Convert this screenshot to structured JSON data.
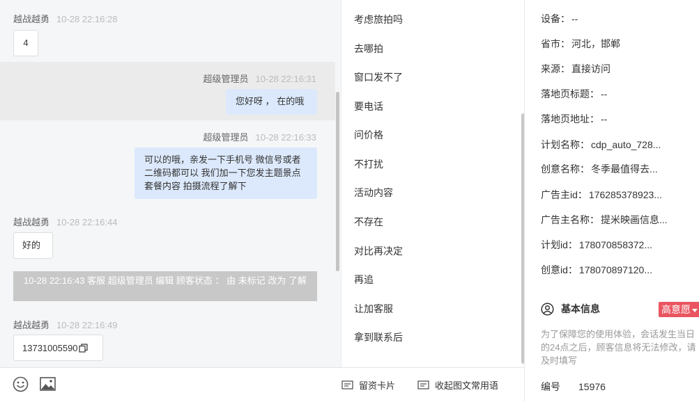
{
  "chat": {
    "messages": [
      {
        "sender": "越战越勇",
        "time": "10-28 22:16:28",
        "text": "4"
      },
      {
        "sender": "超级管理员",
        "time": "10-28 22:16:31",
        "text": "您好呀 ， 在的哦"
      },
      {
        "sender": "超级管理员",
        "time": "10-28 22:16:33",
        "text": "可以的哦，亲发一下手机号 微信号或者二维码都可以 我们加一下您发主题景点 套餐内容 拍摄流程了解下"
      },
      {
        "sender": "越战越勇",
        "time": "10-28 22:16:44",
        "text": "好的"
      },
      {
        "sender": "越战越勇",
        "time": "10-28 22:16:49",
        "text": "13731005590"
      }
    ],
    "system_note": "10-28 22:16:43 客服 超级管理员 编辑 顾客状态 ： 由 未标记 改为 了解"
  },
  "toolbar": {
    "lead_card_label": "留资卡片",
    "collapse_phrases_label": "收起图文常用语"
  },
  "phrases": [
    "考虑旅拍吗",
    "去哪拍",
    "窗口发不了",
    "要电话",
    "问价格",
    "不打扰",
    "活动内容",
    "不存在",
    "对比再决定",
    "再追",
    "让加客服",
    "拿到联系后"
  ],
  "info": {
    "fields": [
      {
        "label": "设备：",
        "value": "--"
      },
      {
        "label": "省市：",
        "value": "河北，邯郸"
      },
      {
        "label": "来源：",
        "value": "直接访问"
      },
      {
        "label": "落地页标题：",
        "value": "--"
      },
      {
        "label": "落地页地址：",
        "value": "--"
      },
      {
        "label": "计划名称：",
        "value": "cdp_auto_728..."
      },
      {
        "label": "创意名称：",
        "value": "冬季最值得去..."
      },
      {
        "label": "广告主id：",
        "value": "176285378923..."
      },
      {
        "label": "广告主名称：",
        "value": "提米映画信息..."
      },
      {
        "label": "计划id：",
        "value": "178070858372..."
      },
      {
        "label": "创意id：",
        "value": "178070897120..."
      }
    ],
    "basic_section_title": "基本信息",
    "intent_badge": "高意愿",
    "notice": "为了保障您的使用体验，会话发生当日的24点之后，顾客信息将无法修改，请及时填写",
    "id_label": "编号",
    "id_value": "15976"
  },
  "colors": {
    "outgoing_bubble": "#dce9fc",
    "intent_badge": "#e95560",
    "system_note": "#c8c8c8"
  },
  "icons": [
    "emoji-icon",
    "image-icon",
    "card-icon",
    "message-icon",
    "user-circle-icon",
    "copy-icon"
  ]
}
